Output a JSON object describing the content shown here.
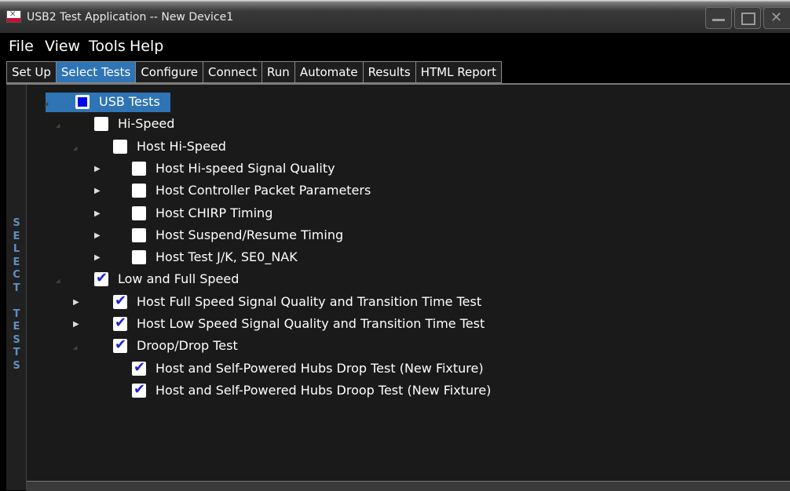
{
  "window": {
    "title": "USB2 Test Application -- New Device1",
    "icon": "app-logo-icon",
    "buttons": [
      "minimize-icon",
      "maximize-icon",
      "close-icon"
    ]
  },
  "menu": [
    "File",
    "View",
    "Tools",
    "Help"
  ],
  "tabs": [
    {
      "label": "Set Up",
      "active": false
    },
    {
      "label": "Select Tests",
      "active": true
    },
    {
      "label": "Configure",
      "active": false
    },
    {
      "label": "Connect",
      "active": false
    },
    {
      "label": "Run",
      "active": false
    },
    {
      "label": "Automate",
      "active": false
    },
    {
      "label": "Results",
      "active": false
    },
    {
      "label": "HTML Report",
      "active": false
    }
  ],
  "side_panel": {
    "label": "SELECT TESTS"
  },
  "tree": [
    {
      "label": "USB Tests",
      "depth": 0,
      "expander": "expanded",
      "check": "partial",
      "selected": true
    },
    {
      "label": "Hi-Speed",
      "depth": 1,
      "expander": "expanded",
      "check": "unchecked"
    },
    {
      "label": "Host Hi-Speed",
      "depth": 2,
      "expander": "expanded",
      "check": "unchecked"
    },
    {
      "label": "Host Hi-speed Signal Quality",
      "depth": 3,
      "expander": "collapsed",
      "check": "unchecked"
    },
    {
      "label": "Host Controller Packet Parameters",
      "depth": 3,
      "expander": "collapsed",
      "check": "unchecked"
    },
    {
      "label": "Host CHIRP Timing",
      "depth": 3,
      "expander": "collapsed",
      "check": "unchecked"
    },
    {
      "label": "Host Suspend/Resume Timing",
      "depth": 3,
      "expander": "collapsed",
      "check": "unchecked"
    },
    {
      "label": "Host Test J/K, SE0_NAK",
      "depth": 3,
      "expander": "collapsed",
      "check": "unchecked"
    },
    {
      "label": "Low and Full Speed",
      "depth": 1,
      "expander": "expanded",
      "check": "checked"
    },
    {
      "label": "Host Full Speed Signal Quality and Transition Time Test",
      "depth": 2,
      "expander": "collapsed",
      "check": "checked"
    },
    {
      "label": "Host Low Speed Signal Quality and Transition Time Test",
      "depth": 2,
      "expander": "collapsed",
      "check": "checked"
    },
    {
      "label": "Droop/Drop Test",
      "depth": 2,
      "expander": "expanded",
      "check": "checked"
    },
    {
      "label": "Host and Self-Powered Hubs Drop Test (New Fixture)",
      "depth": 3,
      "expander": "none",
      "check": "checked"
    },
    {
      "label": "Host and Self-Powered Hubs Droop Test  (New Fixture)",
      "depth": 3,
      "expander": "none",
      "check": "checked"
    }
  ]
}
